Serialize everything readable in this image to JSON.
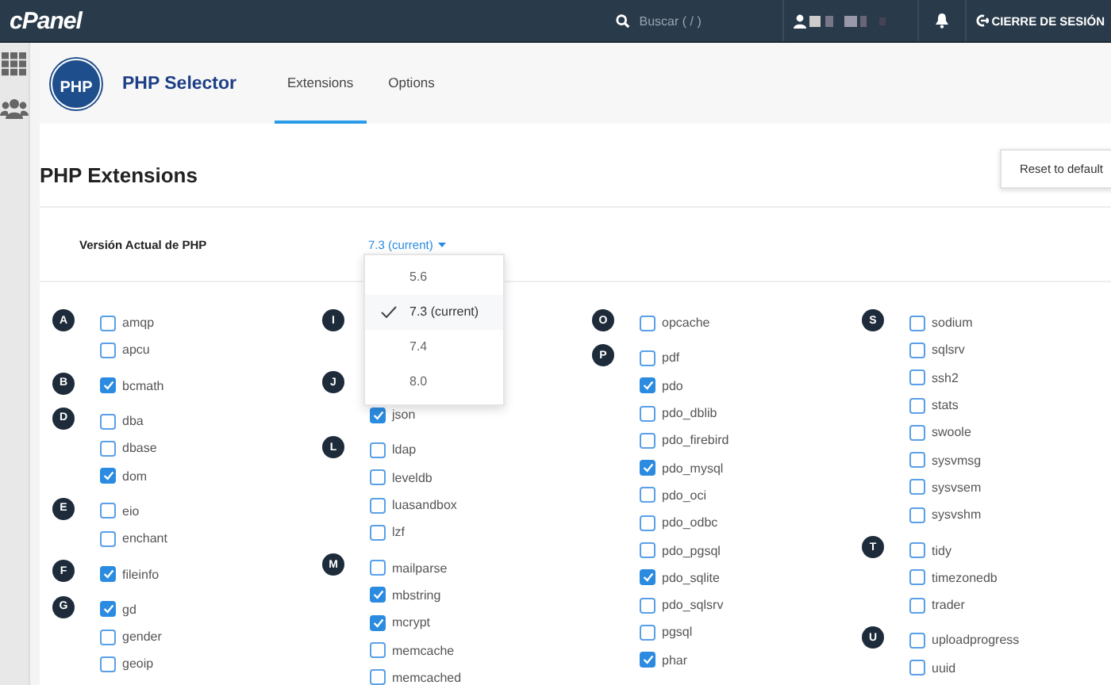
{
  "topbar": {
    "logo": "cPanel",
    "search_placeholder": "Buscar ( / )",
    "logout": "CIERRE DE SESIÓN"
  },
  "header": {
    "logo_text": "PHP",
    "title": "PHP Selector",
    "tabs": [
      {
        "label": "Extensions",
        "selected": true
      },
      {
        "label": "Options",
        "selected": false
      }
    ]
  },
  "section": {
    "title": "PHP Extensions",
    "reset_button": "Reset to default"
  },
  "version": {
    "label": "Versión Actual de PHP",
    "value": "7.3 (current)",
    "dropdown": {
      "expanded": true,
      "options": [
        {
          "label": "5.6",
          "selected": false
        },
        {
          "label": "7.3 (current)",
          "selected": true
        },
        {
          "label": "7.4",
          "selected": false
        },
        {
          "label": "8.0",
          "selected": false
        }
      ]
    }
  },
  "columns": [
    [
      {
        "letter": "A",
        "items": [
          {
            "name": "amqp",
            "checked": false
          },
          {
            "name": "apcu",
            "checked": false
          }
        ]
      },
      {
        "letter": "B",
        "items": [
          {
            "name": "bcmath",
            "checked": true
          }
        ]
      },
      {
        "letter": "D",
        "items": [
          {
            "name": "dba",
            "checked": false
          },
          {
            "name": "dbase",
            "checked": false
          },
          {
            "name": "dom",
            "checked": true
          }
        ]
      },
      {
        "letter": "E",
        "items": [
          {
            "name": "eio",
            "checked": false
          },
          {
            "name": "enchant",
            "checked": false
          }
        ]
      },
      {
        "letter": "F",
        "items": [
          {
            "name": "fileinfo",
            "checked": true
          }
        ]
      },
      {
        "letter": "G",
        "items": [
          {
            "name": "gd",
            "checked": true
          },
          {
            "name": "gender",
            "checked": false
          },
          {
            "name": "geoip",
            "checked": false
          }
        ]
      }
    ],
    [
      {
        "letter": "I"
      },
      {
        "letter": "J",
        "items": [
          {
            "name": "json",
            "checked": true
          }
        ]
      },
      {
        "letter": "L",
        "items": [
          {
            "name": "ldap",
            "checked": false
          },
          {
            "name": "leveldb",
            "checked": false
          },
          {
            "name": "luasandbox",
            "checked": false
          },
          {
            "name": "lzf",
            "checked": false
          }
        ]
      },
      {
        "letter": "M",
        "items": [
          {
            "name": "mailparse",
            "checked": false
          },
          {
            "name": "mbstring",
            "checked": true
          },
          {
            "name": "mcrypt",
            "checked": true
          },
          {
            "name": "memcache",
            "checked": false
          },
          {
            "name": "memcached",
            "checked": false
          }
        ]
      }
    ],
    [
      {
        "letter": "O",
        "items": [
          {
            "name": "opcache",
            "checked": false
          }
        ]
      },
      {
        "letter": "P",
        "items": [
          {
            "name": "pdf",
            "checked": false
          },
          {
            "name": "pdo",
            "checked": true
          },
          {
            "name": "pdo_dblib",
            "checked": false
          },
          {
            "name": "pdo_firebird",
            "checked": false
          },
          {
            "name": "pdo_mysql",
            "checked": true
          },
          {
            "name": "pdo_oci",
            "checked": false
          },
          {
            "name": "pdo_odbc",
            "checked": false
          },
          {
            "name": "pdo_pgsql",
            "checked": false
          },
          {
            "name": "pdo_sqlite",
            "checked": true
          },
          {
            "name": "pdo_sqlsrv",
            "checked": false
          },
          {
            "name": "pgsql",
            "checked": false
          },
          {
            "name": "phar",
            "checked": true
          }
        ]
      }
    ],
    [
      {
        "letter": "S",
        "items": [
          {
            "name": "sodium",
            "checked": false
          },
          {
            "name": "sqlsrv",
            "checked": false
          },
          {
            "name": "ssh2",
            "checked": false
          },
          {
            "name": "stats",
            "checked": false
          },
          {
            "name": "swoole",
            "checked": false
          },
          {
            "name": "sysvmsg",
            "checked": false
          },
          {
            "name": "sysvsem",
            "checked": false
          },
          {
            "name": "sysvshm",
            "checked": false
          }
        ]
      },
      {
        "letter": "T",
        "items": [
          {
            "name": "tidy",
            "checked": false
          },
          {
            "name": "timezonedb",
            "checked": false
          },
          {
            "name": "trader",
            "checked": false
          }
        ]
      },
      {
        "letter": "U",
        "items": [
          {
            "name": "uploadprogress",
            "checked": false
          },
          {
            "name": "uuid",
            "checked": false
          }
        ]
      }
    ]
  ]
}
